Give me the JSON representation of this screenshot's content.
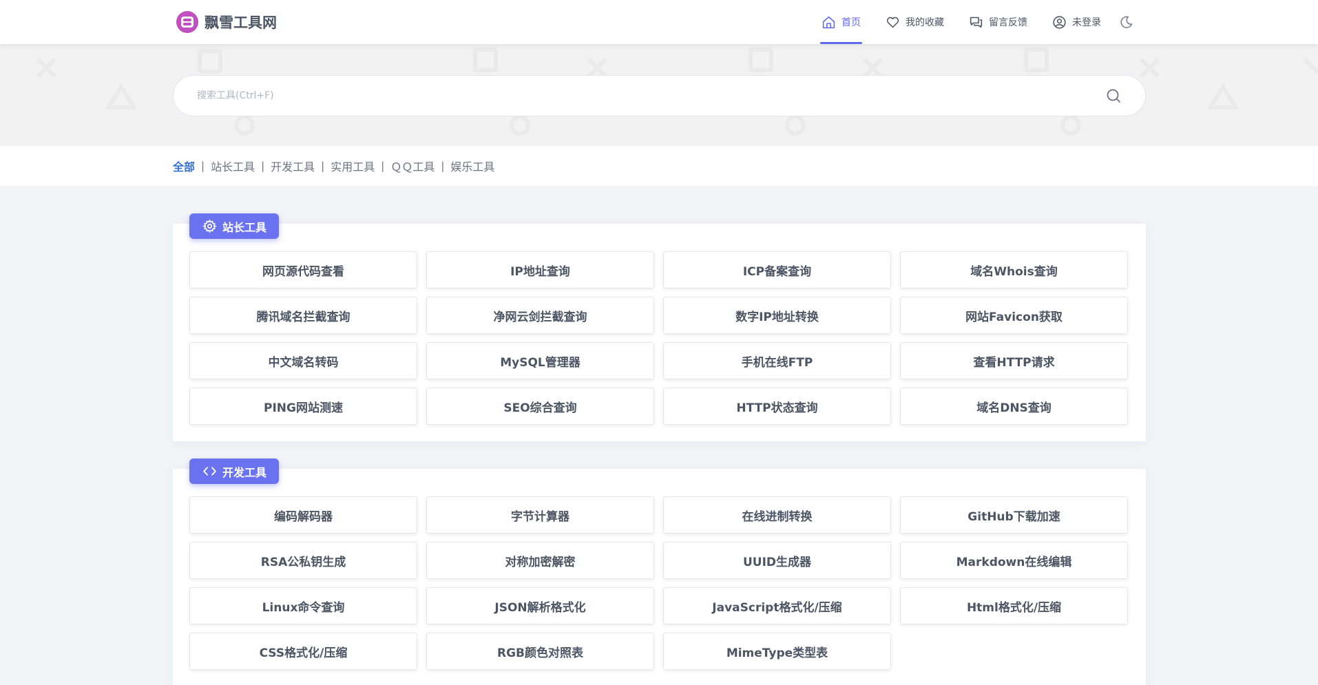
{
  "site": {
    "title": "飘雪工具网"
  },
  "nav": {
    "items": [
      {
        "label": "首页",
        "icon": "home-icon",
        "active": true
      },
      {
        "label": "我的收藏",
        "icon": "heart-icon",
        "active": false
      },
      {
        "label": "留言反馈",
        "icon": "chat-icon",
        "active": false
      },
      {
        "label": "未登录",
        "icon": "user-icon",
        "active": false
      }
    ],
    "theme_icon": "moon-icon"
  },
  "search": {
    "placeholder": "搜索工具(Ctrl+F)"
  },
  "filters": {
    "items": [
      "全部",
      "站长工具",
      "开发工具",
      "实用工具",
      "ＱＱ工具",
      "娱乐工具"
    ],
    "active": "全部"
  },
  "sections": [
    {
      "title": "站长工具",
      "icon": "gear-icon",
      "tools": [
        "网页源代码查看",
        "IP地址查询",
        "ICP备案查询",
        "域名Whois查询",
        "腾讯域名拦截查询",
        "净网云剑拦截查询",
        "数字IP地址转换",
        "网站Favicon获取",
        "中文域名转码",
        "MySQL管理器",
        "手机在线FTP",
        "查看HTTP请求",
        "PING网站测速",
        "SEO综合查询",
        "HTTP状态查询",
        "域名DNS查询"
      ]
    },
    {
      "title": "开发工具",
      "icon": "code-icon",
      "tools": [
        "编码解码器",
        "字节计算器",
        "在线进制转换",
        "GitHub下载加速",
        "RSA公私钥生成",
        "对称加密解密",
        "UUID生成器",
        "Markdown在线编辑",
        "Linux命令查询",
        "JSON解析格式化",
        "JavaScript格式化/压缩",
        "Html格式化/压缩",
        "CSS格式化/压缩",
        "RGB颜色对照表",
        "MimeType类型表"
      ]
    }
  ],
  "colors": {
    "accent": "#6b72f0",
    "filter_active": "#2f6fd6",
    "text": "#4b5563"
  }
}
